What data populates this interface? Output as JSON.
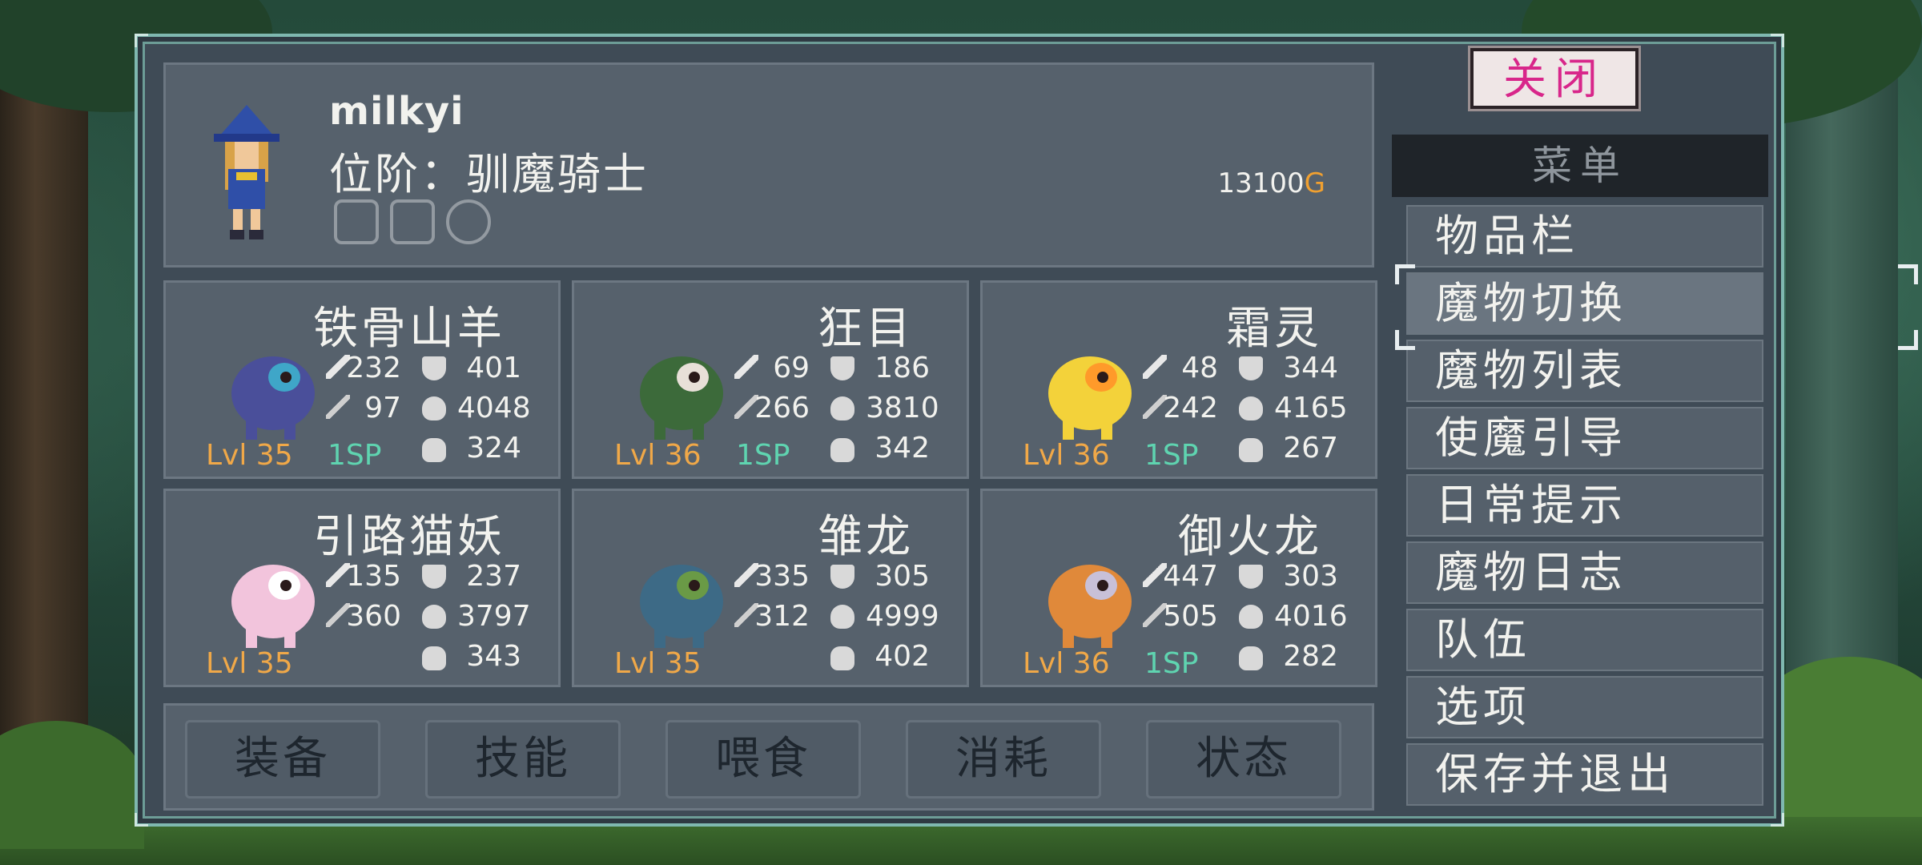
{
  "player": {
    "name": "milkyi",
    "rank": "位阶：驯魔骑士",
    "gold": "13100",
    "gold_unit": "G"
  },
  "monsters": [
    {
      "name": "铁骨山羊",
      "atk": "232",
      "def": "401",
      "mag": "97",
      "hp": "4048",
      "level": "Lvl 35",
      "sp": "1SP",
      "food": "324",
      "color": "#4a4f9a",
      "accent": "#3fa6c8"
    },
    {
      "name": "狂目",
      "atk": "69",
      "def": "186",
      "mag": "266",
      "hp": "3810",
      "level": "Lvl 36",
      "sp": "1SP",
      "food": "342",
      "color": "#3c6a3a",
      "accent": "#e8e0d8"
    },
    {
      "name": "霜灵",
      "atk": "48",
      "def": "344",
      "mag": "242",
      "hp": "4165",
      "level": "Lvl 36",
      "sp": "1SP",
      "food": "267",
      "color": "#f3d23a",
      "accent": "#ff9a2a"
    },
    {
      "name": "引路猫妖",
      "atk": "135",
      "def": "237",
      "mag": "360",
      "hp": "3797",
      "level": "Lvl 35",
      "sp": "",
      "food": "343",
      "color": "#f2c4dc",
      "accent": "#ffffff"
    },
    {
      "name": "雏龙",
      "atk": "335",
      "def": "305",
      "mag": "312",
      "hp": "4999",
      "level": "Lvl 35",
      "sp": "",
      "food": "402",
      "color": "#3d6a86",
      "accent": "#6a9a46"
    },
    {
      "name": "御火龙",
      "atk": "447",
      "def": "303",
      "mag": "505",
      "hp": "4016",
      "level": "Lvl 36",
      "sp": "1SP",
      "food": "282",
      "color": "#e0893a",
      "accent": "#c8c0d8"
    }
  ],
  "actions": [
    "装备",
    "技能",
    "喂食",
    "消耗",
    "状态"
  ],
  "close_label": "关闭",
  "menu": {
    "header": "菜单",
    "items": [
      "物品栏",
      "魔物切换",
      "魔物列表",
      "使魔引导",
      "日常提示",
      "魔物日志",
      "队伍",
      "选项",
      "保存并退出"
    ],
    "selected": "魔物切换"
  },
  "colors": {
    "window_bg": "#3f4b56",
    "panel_bg": "#56616c",
    "frame": "#7fb8b0",
    "level": "#f0a848",
    "sp": "#5fd4b0",
    "gold": "#f0a030",
    "close_text": "#d8268a"
  },
  "icons": {
    "attack": "sword-icon",
    "defense": "shield-icon",
    "magic": "wand-icon",
    "health": "heart-icon",
    "food": "food-bag-icon"
  }
}
